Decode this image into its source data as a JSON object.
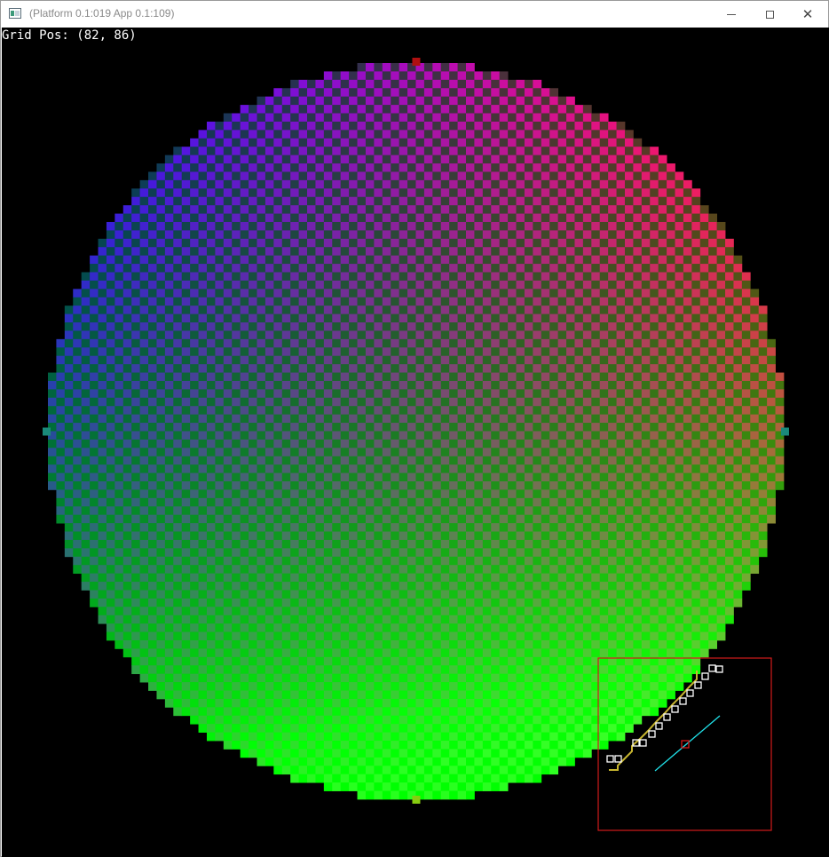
{
  "window": {
    "title": "(Platform 0.1:019 App 0.1:109)"
  },
  "controls": {
    "minimize_icon": "minimize-icon",
    "maximize_icon": "maximize-icon",
    "close_glyph": "✕"
  },
  "overlay": {
    "grid_pos_text": "Grid Pos: (82, 86)"
  },
  "colors": {
    "background": "#000000",
    "selection_box": "#d11a1a",
    "edge_outline": "#c8b630",
    "cursor_line": "#20e0e8",
    "highlight_cell": "#ffffff"
  },
  "grid": {
    "cols": 88,
    "rows": 88,
    "radius_cells": 44,
    "hovered_cell": [
      82,
      86
    ]
  }
}
